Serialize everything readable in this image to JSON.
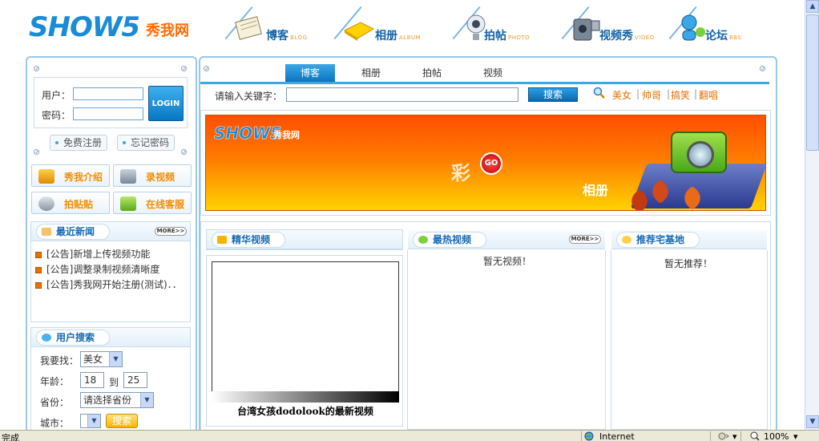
{
  "header": {
    "logo_en": "SHOW5",
    "logo_cn": "秀我网",
    "nav": [
      {
        "label": "博客",
        "sub": "BLOG",
        "icon": "notebook-icon"
      },
      {
        "label": "相册",
        "sub": "ALBUM",
        "icon": "album-icon"
      },
      {
        "label": "拍帖",
        "sub": "PHOTO",
        "icon": "webcam-icon"
      },
      {
        "label": "视频秀",
        "sub": "VIDEO",
        "icon": "camcorder-icon"
      },
      {
        "label": "论坛",
        "sub": "BBS",
        "icon": "forum-user-icon"
      }
    ]
  },
  "login": {
    "user_label": "用户：",
    "pass_label": "密码：",
    "login_button": "LOGIN",
    "register": "免费注册",
    "forgot": "忘记密码"
  },
  "quick_links": [
    "秀我介绍",
    "录视频",
    "拍贴贴",
    "在线客服"
  ],
  "news": {
    "title": "最近新闻",
    "more": "MORE>>",
    "items": [
      "[公告]新增上传视频功能",
      "[公告]调整录制视频清晰度",
      "[公告]秀我网开始注册(测试)．．"
    ]
  },
  "user_search": {
    "title": "用户搜索",
    "find_label": "我要找：",
    "find_value": "美女",
    "age_label": "年龄：",
    "age_from": "18",
    "age_to_label": "到",
    "age_to": "25",
    "province_label": "省份：",
    "province_value": "请选择省份",
    "city_label": "城市：",
    "city_value": "",
    "search_button": "搜索"
  },
  "tabs": [
    "博客",
    "相册",
    "拍帖",
    "视频"
  ],
  "search": {
    "label": "请输入关键字：",
    "value": "",
    "button": "搜索",
    "hot": [
      "美女",
      "帅哥",
      "搞笑",
      "翻唱"
    ]
  },
  "banner": {
    "logo_en": "SHOW5",
    "logo_cn": "秀我网",
    "cai": "彩",
    "go": "GO",
    "album": "相册"
  },
  "featured_video": {
    "title": "精华视频",
    "caption": "台湾女孩dodolook的最新视频"
  },
  "hot_video": {
    "title": "最热视频",
    "more": "MORE>>",
    "empty": "暂无视频！"
  },
  "recommend": {
    "title": "推荐宅基地",
    "empty": "暂无推荐！"
  },
  "statusbar": {
    "done": "完成",
    "zone": "Internet",
    "zoom": "100%"
  }
}
